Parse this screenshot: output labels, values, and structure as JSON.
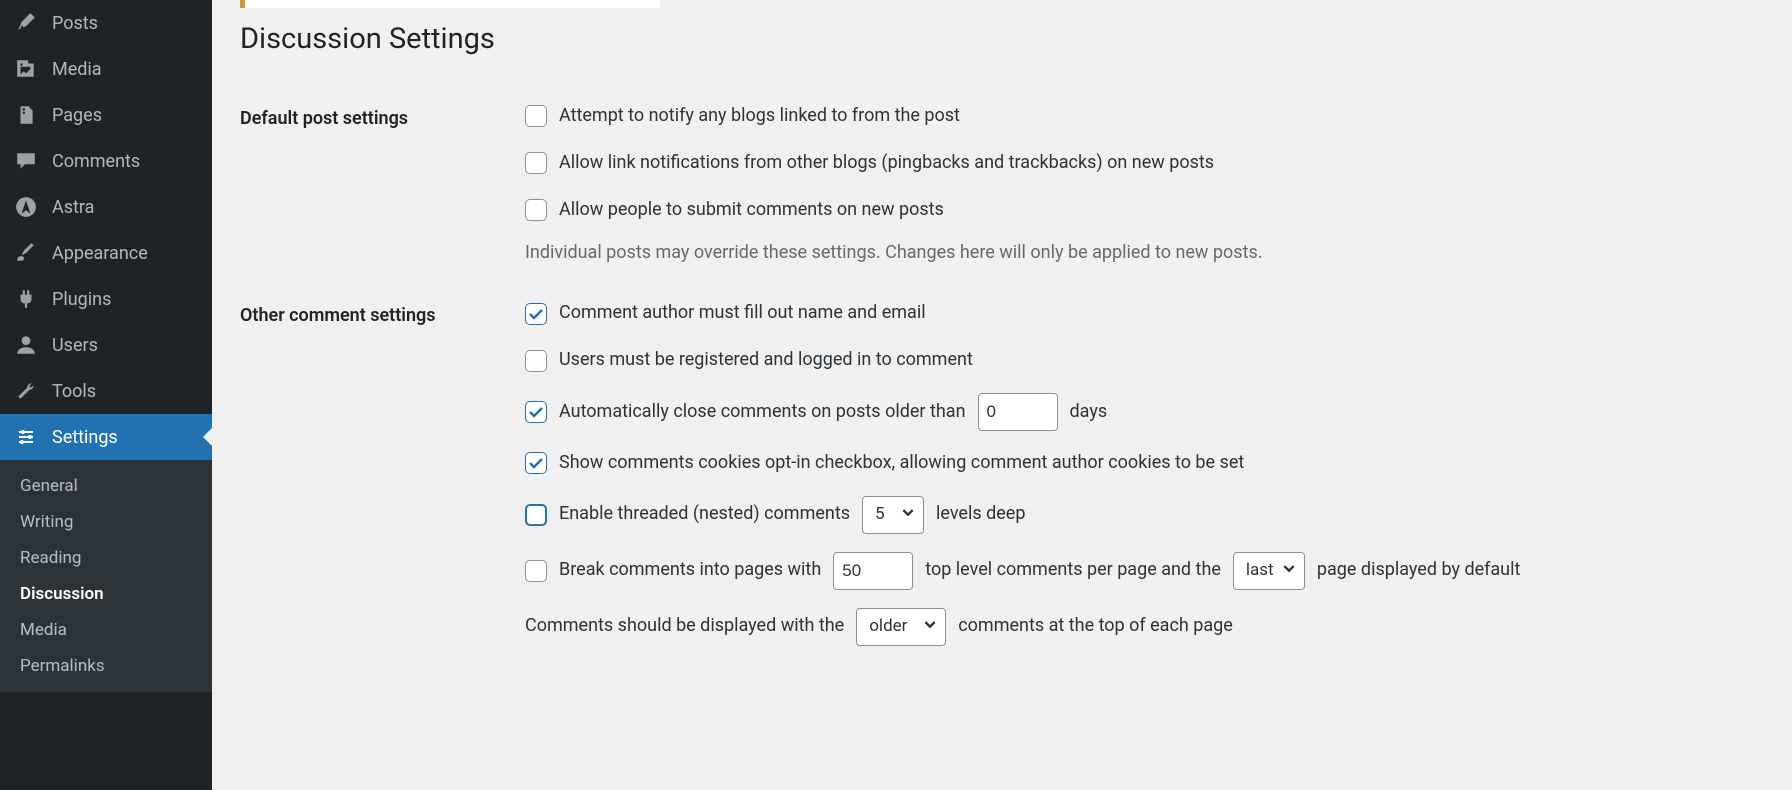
{
  "sidebar": {
    "items": [
      {
        "label": "Posts"
      },
      {
        "label": "Media"
      },
      {
        "label": "Pages"
      },
      {
        "label": "Comments"
      },
      {
        "label": "Astra"
      },
      {
        "label": "Appearance"
      },
      {
        "label": "Plugins"
      },
      {
        "label": "Users"
      },
      {
        "label": "Tools"
      },
      {
        "label": "Settings"
      }
    ],
    "submenu": [
      {
        "label": "General"
      },
      {
        "label": "Writing"
      },
      {
        "label": "Reading"
      },
      {
        "label": "Discussion"
      },
      {
        "label": "Media"
      },
      {
        "label": "Permalinks"
      }
    ]
  },
  "page": {
    "title": "Discussion Settings"
  },
  "sections": {
    "default_post": {
      "heading": "Default post settings",
      "opt1": "Attempt to notify any blogs linked to from the post",
      "opt2": "Allow link notifications from other blogs (pingbacks and trackbacks) on new posts",
      "opt3": "Allow people to submit comments on new posts",
      "desc": "Individual posts may override these settings. Changes here will only be applied to new posts."
    },
    "other_comment": {
      "heading": "Other comment settings",
      "opt1": "Comment author must fill out name and email",
      "opt2": "Users must be registered and logged in to comment",
      "opt3_pre": "Automatically close comments on posts older than",
      "opt3_val": "0",
      "opt3_post": "days",
      "opt4": "Show comments cookies opt-in checkbox, allowing comment author cookies to be set",
      "opt5_pre": "Enable threaded (nested) comments",
      "opt5_val": "5",
      "opt5_post": "levels deep",
      "opt6_pre": "Break comments into pages with",
      "opt6_val": "50",
      "opt6_mid": "top level comments per page and the",
      "opt6_sel": "last",
      "opt6_post": "page displayed by default",
      "opt7_pre": "Comments should be displayed with the",
      "opt7_sel": "older",
      "opt7_post": "comments at the top of each page"
    }
  }
}
